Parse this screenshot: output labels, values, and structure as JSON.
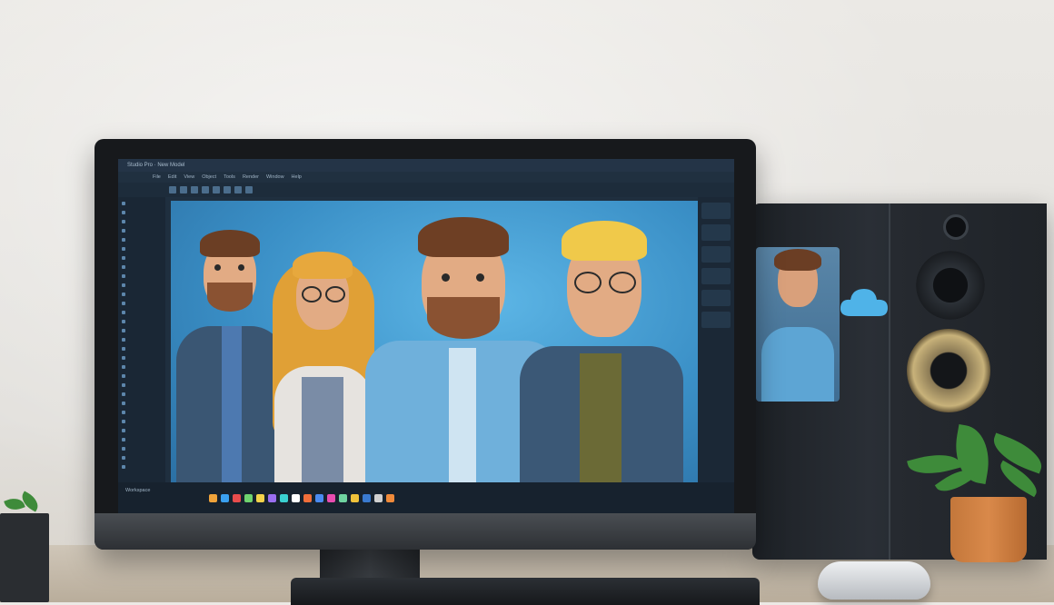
{
  "scene": {
    "description_tag": "desk-setup",
    "monitor": {
      "window_title": "Studio Pro · New Model",
      "menu": [
        "File",
        "Edit",
        "View",
        "Object",
        "Tools",
        "Render",
        "Window",
        "Help"
      ],
      "taskbar_label": "Workspace"
    },
    "colors": {
      "accent": "#3a8fc6",
      "ui_dark": "#1f2f3f",
      "cloud": "#4fb3e8"
    },
    "icons": [
      "cloud-icon",
      "speaker",
      "plant",
      "mouse"
    ]
  }
}
